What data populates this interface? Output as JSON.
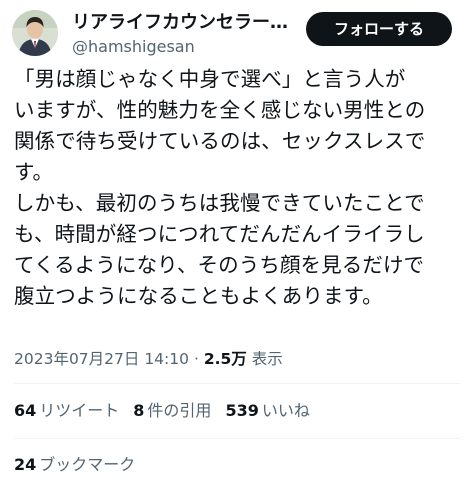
{
  "header": {
    "display_name": "リアライフカウンセラー…",
    "handle": "@hamshigesan",
    "follow_label": "フォローする"
  },
  "post": {
    "lines": [
      "「男は顔じゃなく中身で選べ」と言う人が",
      "いますが、性的魅力を全く感じない男性との",
      "関係で待ち受けているのは、セックスレスで",
      "す。",
      "しかも、最初のうちは我慢できていたことで",
      "も、時間が経つにつれてだんだんイライラし",
      "てくるようになり、そのうち顔を見るだけで",
      "腹立つようになることもよくあります。"
    ]
  },
  "meta": {
    "timestamp": "2023年07月27日 14:10",
    "separator": "·",
    "views_count": "2.5万",
    "views_label": "表示"
  },
  "stats": {
    "retweets_count": "64",
    "retweets_label": "リツイート",
    "quotes_count": "8",
    "quotes_label": "件の引用",
    "likes_count": "539",
    "likes_label": "いいね",
    "bookmarks_count": "24",
    "bookmarks_label": "ブックマーク"
  },
  "colors": {
    "text": "#0f1419",
    "secondary": "#536471",
    "button_bg": "#0f1419",
    "divider": "#eff3f4"
  }
}
